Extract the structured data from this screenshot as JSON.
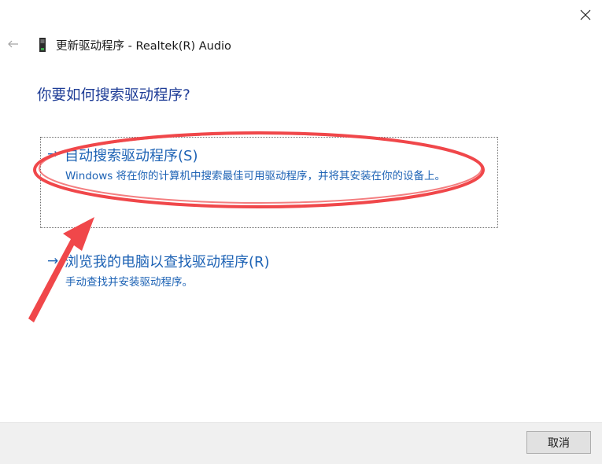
{
  "window": {
    "title": "更新驱动程序 - Realtek(R) Audio",
    "close_icon": "close-icon",
    "back_icon": "back-arrow-icon",
    "device_icon": "audio-device-icon"
  },
  "heading": "你要如何搜索驱动程序?",
  "options": [
    {
      "arrow": "→",
      "title": "自动搜索驱动程序(S)",
      "description": "Windows 将在你的计算机中搜索最佳可用驱动程序，并将其安装在你的设备上。"
    },
    {
      "arrow": "→",
      "title": "浏览我的电脑以查找驱动程序(R)",
      "description": "手动查找并安装驱动程序。"
    }
  ],
  "footer": {
    "cancel_label": "取消"
  },
  "colors": {
    "link": "#1e63b5",
    "heading": "#1e3c96",
    "annotation": "#f0474a",
    "footer_bg": "#f0f0f0"
  }
}
